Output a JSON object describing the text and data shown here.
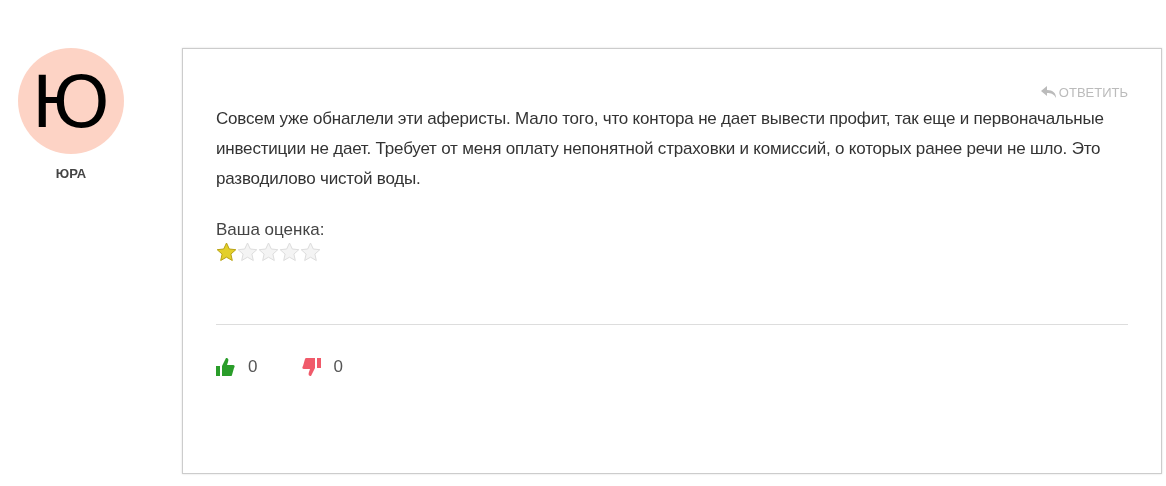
{
  "author": {
    "initial": "Ю",
    "name": "ЮРА"
  },
  "comment": {
    "reply": "ОТВЕТИТЬ",
    "text": "Совсем уже обнаглели эти аферисты. Мало того, что контора не дает вывести профит, так еще и первоначальные инвестиции не дает. Требует от меня оплату непонятной страховки и комиссий, о которых ранее речи не шло. Это разводилово чистой воды.",
    "rating_label": "Ваша оценка:",
    "stars": 1,
    "likes": "0",
    "dislikes": "0"
  }
}
